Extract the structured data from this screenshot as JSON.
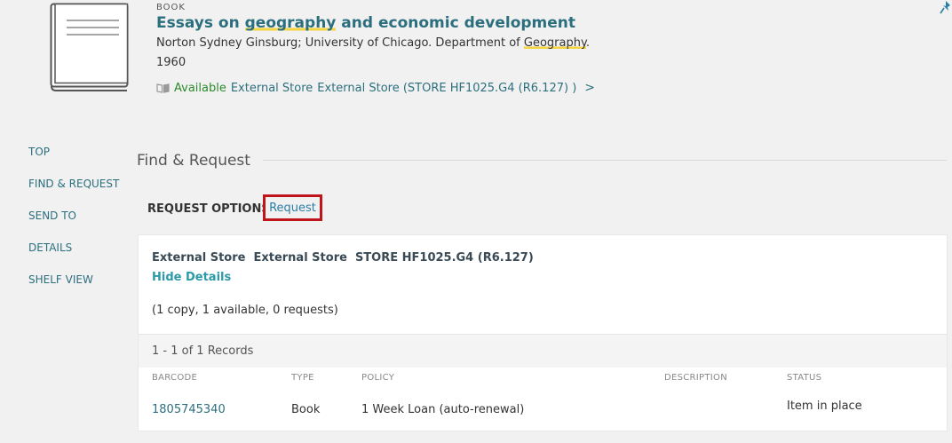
{
  "record": {
    "type": "BOOK",
    "title_parts": [
      "Essays on ",
      "geography",
      " and economic development"
    ],
    "authors_parts": [
      "Norton Sydney Ginsburg; University of Chicago. Department of ",
      "Geography",
      "."
    ],
    "year": "1960",
    "availability": {
      "status": "Available",
      "location": "External Store",
      "detail": "External Store (STORE HF1025.G4 (R6.127) )",
      "chevron": ">"
    }
  },
  "nav": [
    "TOP",
    "FIND & REQUEST",
    "SEND TO",
    "DETAILS",
    "SHELF VIEW"
  ],
  "section": {
    "title": "Find & Request",
    "request_options_label": "REQUEST OPTIONS:",
    "request_label": "Request"
  },
  "holding": {
    "library": "External Store",
    "location": "External Store",
    "call_number": "STORE HF1025.G4 (R6.127)",
    "hide_details": "Hide Details",
    "copies": "(1 copy, 1 available, 0 requests)",
    "records_count": "1 - 1 of 1 Records",
    "columns": [
      "BARCODE",
      "TYPE",
      "POLICY",
      "DESCRIPTION",
      "STATUS"
    ],
    "rows": [
      {
        "barcode": "1805745340",
        "type": "Book",
        "policy": "1 Week Loan (auto-renewal)",
        "description": "",
        "status": "Item in place"
      }
    ]
  },
  "colors": {
    "accent": "#2b6f7e",
    "available": "#2c8a2c",
    "highlight": "#f4d441",
    "request_border": "#c0141b"
  },
  "icons": {
    "record": "book-cover-icon",
    "pin": "pin-icon",
    "availability": "open-book-icon"
  }
}
